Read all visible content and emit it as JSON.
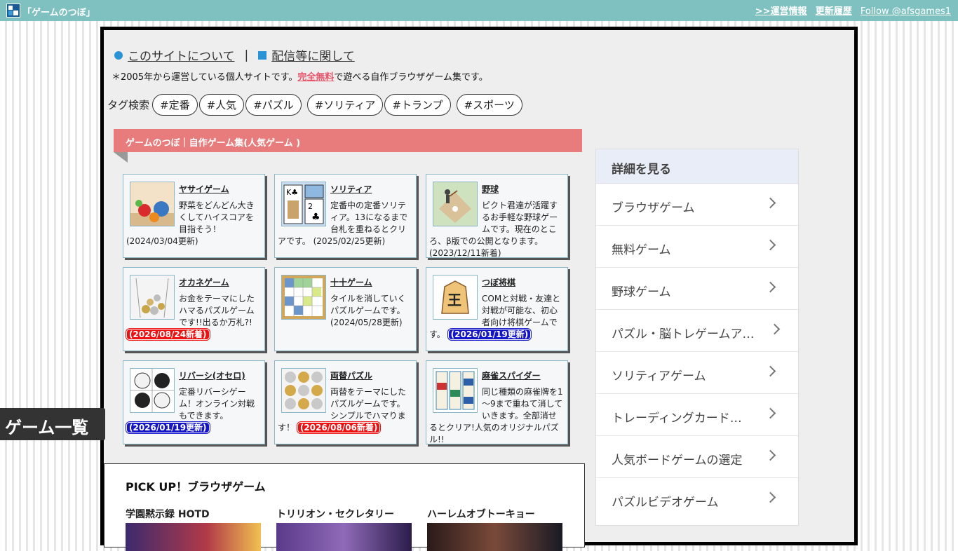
{
  "header": {
    "title": "「ゲームのつぼ」",
    "links": [
      {
        "label": ">>運営情報"
      },
      {
        "label": "更新履歴"
      },
      {
        "label": "Follow @afsgames1"
      }
    ]
  },
  "about": {
    "link1": "このサイトについて",
    "separator": "|",
    "link2": "配信等に関して"
  },
  "intro": {
    "before": "＊2005年から運営している個人サイトです。",
    "highlight": "完全無料",
    "after": "で遊べる自作ブラウザゲーム集です。"
  },
  "tags": {
    "label": "タグ検索",
    "items": [
      "#定番",
      "#人気",
      "#パズル",
      "#ソリティア",
      "#トランプ",
      "#スポーツ"
    ]
  },
  "game_list": {
    "header": "ゲームのつぼ｜自作ゲーム集(人気ゲーム )",
    "games": [
      {
        "title": "ヤサイゲーム",
        "desc": "野菜をどんどん大きくしてハイスコアを目指そう！(2024/03/04更新)",
        "badge": ""
      },
      {
        "title": "ソリティア",
        "desc": "定番中の定番ソリティア。13になるまで台札を重ねるとクリアです。 (2025/02/25更新)",
        "badge": ""
      },
      {
        "title": "野球",
        "desc": "ピクト君達が活躍するお手軽な野球ゲームです。現在のところ、β版での公開となります。(2023/12/11新着)",
        "badge": ""
      },
      {
        "title": "オカネゲーム",
        "desc": "お金をテーマにしたハマるパズルゲームです!!出るか万札?!",
        "badge": "(2026/08/24新着)"
      },
      {
        "title": "十十ゲーム",
        "desc": "タイルを消していくパズルゲームです。(2024/05/28更新)",
        "badge": ""
      },
      {
        "title": "つぼ将棋",
        "desc": "COMと対戦・友達と対戦が可能な、初心者向け将棋ゲームです。",
        "badge": "(2026/01/19更新)"
      },
      {
        "title": "リバーシ(オセロ)",
        "desc": "定番リバーシゲーム！オンライン対戦もできます。",
        "badge": "(2026/01/19更新)"
      },
      {
        "title": "両替パズル",
        "desc": "両替をテーマにしたパズルゲームです。シンプルでハマります！",
        "badge": "(2026/08/06新着)"
      },
      {
        "title": "麻雀スパイダー",
        "desc": "同じ種類の麻雀牌を1～9まで重ねて消していきます。全部消せるとクリア!人気のオリジナルパズル!!",
        "badge": ""
      }
    ]
  },
  "side_tab": {
    "label": "ゲーム一覧"
  },
  "pickup": {
    "title": "PICK UP！ブラウザゲーム",
    "items": [
      "学園黙示録 HOTD",
      "トリリオン・セクレタリー",
      "ハーレムオブトーキョー"
    ]
  },
  "sidebar": {
    "header": "詳細を見る",
    "items": [
      "ブラウザゲーム",
      "無料ゲーム",
      "野球ゲーム",
      "パズル・脳トレゲームア…",
      "ソリティアゲーム",
      "トレーディングカード…",
      "人気ボードゲームの選定",
      "パズルビデオゲーム"
    ]
  },
  "colors": {
    "topbar": "#7fc1c1",
    "list_header": "#e87b7b",
    "accent_blue": "#2a93d5",
    "new_badge": "#e11111",
    "update_badge": "#1515c8"
  }
}
